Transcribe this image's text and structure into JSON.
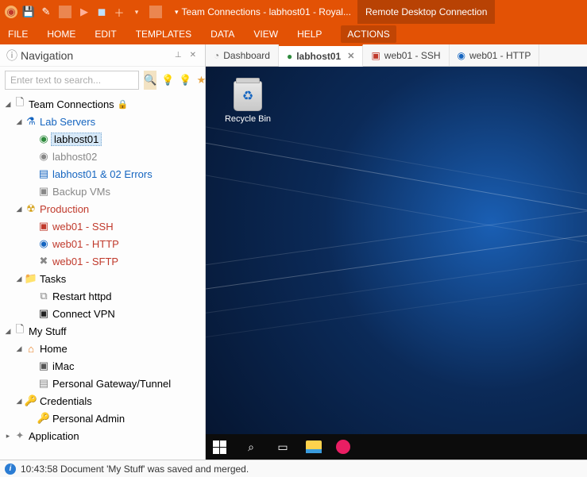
{
  "titlebar": {
    "caption_left": "Team Connections - labhost01 - Royal...",
    "caption_right": "Remote Desktop Connection"
  },
  "menus": [
    "FILE",
    "HOME",
    "EDIT",
    "TEMPLATES",
    "DATA",
    "VIEW",
    "HELP",
    "ACTIONS"
  ],
  "nav": {
    "title": "Navigation",
    "search_placeholder": "Enter text to search...",
    "tree": {
      "root1": {
        "label": "Team Connections"
      },
      "lab": {
        "label": "Lab Servers"
      },
      "lab_items": [
        "labhost01",
        "labhost02",
        "labhost01 & 02 Errors",
        "Backup VMs"
      ],
      "prod": {
        "label": "Production"
      },
      "prod_items": [
        "web01 - SSH",
        "web01 - HTTP",
        "web01 - SFTP"
      ],
      "tasks": {
        "label": "Tasks"
      },
      "tasks_items": [
        "Restart httpd",
        "Connect VPN"
      ],
      "root2": {
        "label": "My Stuff"
      },
      "home": {
        "label": "Home"
      },
      "home_items": [
        "iMac",
        "Personal Gateway/Tunnel"
      ],
      "cred": {
        "label": "Credentials"
      },
      "cred_items": [
        "Personal Admin"
      ],
      "root3": {
        "label": "Application"
      }
    }
  },
  "tabs": [
    {
      "label": "Dashboard",
      "icon": "◔"
    },
    {
      "label": "labhost01",
      "icon": "●",
      "active": true
    },
    {
      "label": "web01 - SSH",
      "icon": "▣"
    },
    {
      "label": "web01 - HTTP",
      "icon": "◉"
    }
  ],
  "desktop": {
    "recycle_label": "Recycle Bin"
  },
  "status": {
    "text": "10:43:58 Document 'My Stuff' was saved and merged."
  }
}
